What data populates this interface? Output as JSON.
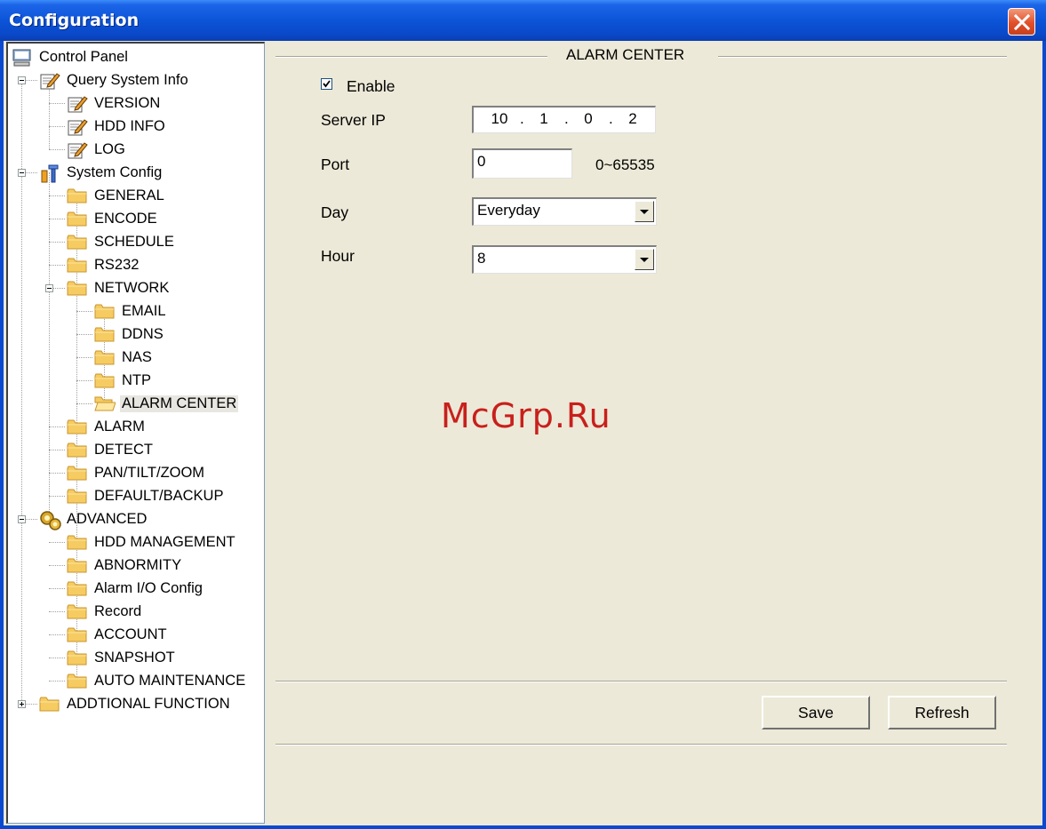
{
  "window": {
    "title": "Configuration"
  },
  "tree": {
    "items": [
      {
        "label": "Control Panel",
        "icon": "monitor-icon"
      },
      {
        "label": "Query System Info",
        "icon": "notepad-icon"
      },
      {
        "label": "VERSION",
        "icon": "notepad-icon"
      },
      {
        "label": "HDD INFO",
        "icon": "notepad-icon"
      },
      {
        "label": "LOG",
        "icon": "notepad-icon"
      },
      {
        "label": "System Config",
        "icon": "tools-icon"
      },
      {
        "label": "GENERAL",
        "icon": "folder-icon"
      },
      {
        "label": "ENCODE",
        "icon": "folder-icon"
      },
      {
        "label": "SCHEDULE",
        "icon": "folder-icon"
      },
      {
        "label": "RS232",
        "icon": "folder-icon"
      },
      {
        "label": "NETWORK",
        "icon": "folder-icon"
      },
      {
        "label": "EMAIL",
        "icon": "folder-icon"
      },
      {
        "label": "DDNS",
        "icon": "folder-icon"
      },
      {
        "label": "NAS",
        "icon": "folder-icon"
      },
      {
        "label": "NTP",
        "icon": "folder-icon"
      },
      {
        "label": "ALARM CENTER",
        "icon": "folder-open-icon"
      },
      {
        "label": "ALARM",
        "icon": "folder-icon"
      },
      {
        "label": "DETECT",
        "icon": "folder-icon"
      },
      {
        "label": "PAN/TILT/ZOOM",
        "icon": "folder-icon"
      },
      {
        "label": "DEFAULT/BACKUP",
        "icon": "folder-icon"
      },
      {
        "label": "ADVANCED",
        "icon": "gears-icon"
      },
      {
        "label": "HDD MANAGEMENT",
        "icon": "folder-icon"
      },
      {
        "label": "ABNORMITY",
        "icon": "folder-icon"
      },
      {
        "label": "Alarm I/O Config",
        "icon": "folder-icon"
      },
      {
        "label": "Record",
        "icon": "folder-icon"
      },
      {
        "label": "ACCOUNT",
        "icon": "folder-icon"
      },
      {
        "label": "SNAPSHOT",
        "icon": "folder-icon"
      },
      {
        "label": "AUTO MAINTENANCE",
        "icon": "folder-icon"
      },
      {
        "label": "ADDTIONAL FUNCTION",
        "icon": "folder-icon"
      }
    ]
  },
  "panel": {
    "section_title": "ALARM CENTER",
    "enable": {
      "label": "Enable",
      "checked": true
    },
    "server_ip": {
      "label": "Server IP",
      "octets": [
        "10",
        "1",
        "0",
        "2"
      ]
    },
    "port": {
      "label": "Port",
      "value": "0",
      "range": "0~65535"
    },
    "day": {
      "label": "Day",
      "value": "Everyday"
    },
    "hour": {
      "label": "Hour",
      "value": "8"
    },
    "save_label": "Save",
    "refresh_label": "Refresh"
  },
  "watermark": "McGrp.Ru"
}
